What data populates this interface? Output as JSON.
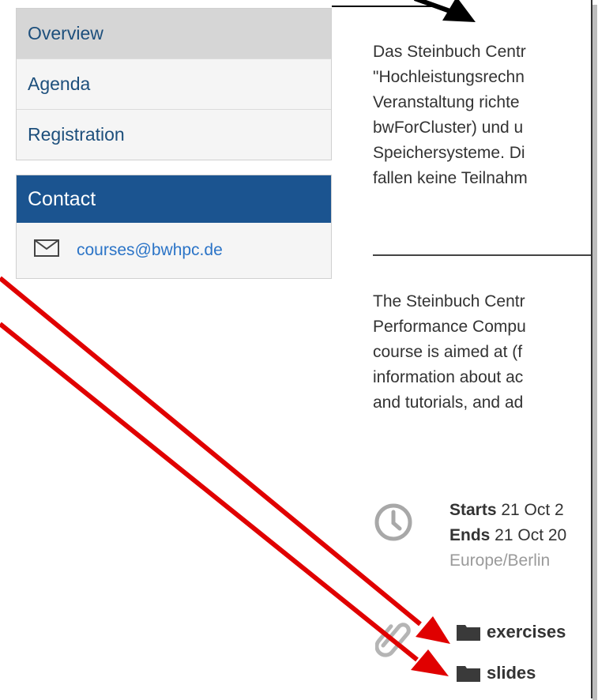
{
  "sidebar": {
    "menu": [
      {
        "label": "Overview",
        "active": true
      },
      {
        "label": "Agenda",
        "active": false
      },
      {
        "label": "Registration",
        "active": false
      }
    ],
    "contact": {
      "title": "Contact",
      "email": "courses@bwhpc.de",
      "icon": "envelope-icon"
    }
  },
  "main": {
    "german_lines": [
      "Das Steinbuch Centr",
      "\"Hochleistungsrechn",
      "Veranstaltung richte",
      "bwForCluster)  und u",
      "Speichersysteme. Di",
      "fallen keine Teilnahm"
    ],
    "english_lines": [
      "The Steinbuch Centr",
      "Performance Compu",
      "course is aimed at (f",
      "information about ac",
      "and tutorials, and ad"
    ],
    "event": {
      "starts_label": "Starts",
      "starts_value": " 21 Oct 2",
      "ends_label": "Ends",
      "ends_value": " 21 Oct 20",
      "timezone": "Europe/Berlin",
      "icon": "clock-icon"
    },
    "attachments": [
      {
        "label": "exercises",
        "icon": "folder-icon"
      },
      {
        "label": "slides",
        "icon": "folder-icon"
      }
    ],
    "attachment_icon": "paperclip-icon"
  },
  "colors": {
    "accent": "#1b5490",
    "link": "#2b74c7",
    "annotation": "#e00000"
  }
}
